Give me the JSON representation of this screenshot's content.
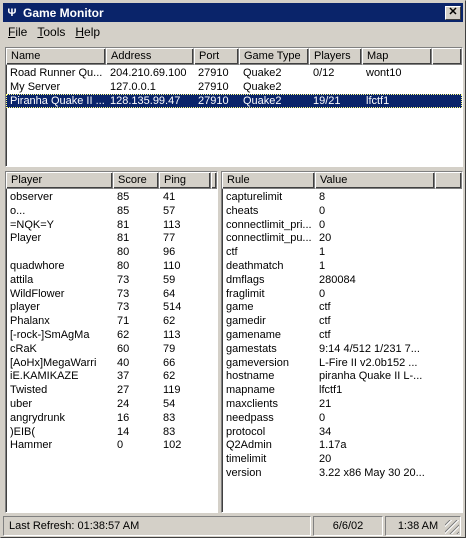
{
  "window": {
    "title": "Game Monitor",
    "app_icon": "Ψ",
    "close_glyph": "✕"
  },
  "menu": [
    {
      "label": "File",
      "mnemonic": "F",
      "rest": "ile"
    },
    {
      "label": "Tools",
      "mnemonic": "T",
      "rest": "ools"
    },
    {
      "label": "Help",
      "mnemonic": "H",
      "rest": "elp"
    }
  ],
  "servers": {
    "columns": [
      "Name",
      "Address",
      "Port",
      "Game Type",
      "Players",
      "Map"
    ],
    "rows": [
      {
        "name": "Road Runner Qu...",
        "address": "204.210.69.100",
        "port": "27910",
        "type": "Quake2",
        "players": "0/12",
        "map": "wont10",
        "selected": false
      },
      {
        "name": "My Server",
        "address": "127.0.0.1",
        "port": "27910",
        "type": "Quake2",
        "players": "",
        "map": "",
        "selected": false
      },
      {
        "name": "Piranha Quake II ...",
        "address": "128.135.99.47",
        "port": "27910",
        "type": "Quake2",
        "players": "19/21",
        "map": "lfctf1",
        "selected": true
      }
    ]
  },
  "players": {
    "columns": [
      "Player",
      "Score",
      "Ping"
    ],
    "rows": [
      [
        "observer",
        "85",
        "41"
      ],
      [
        "o...",
        "85",
        "57"
      ],
      [
        "=NQK=Y",
        "81",
        "113"
      ],
      [
        "Player",
        "81",
        "77"
      ],
      [
        "",
        "80",
        "96"
      ],
      [
        "quadwhore",
        "80",
        "110"
      ],
      [
        "attila",
        "73",
        "59"
      ],
      [
        "WildFlower",
        "73",
        "64"
      ],
      [
        "player",
        "73",
        "514"
      ],
      [
        "Phalanx",
        "71",
        "62"
      ],
      [
        "[-rock-]SmAgMa",
        "62",
        "113"
      ],
      [
        "cRaK",
        "60",
        "79"
      ],
      [
        "[AoHx]MegaWarri",
        "40",
        "66"
      ],
      [
        "iE.KAMIKAZE",
        "37",
        "62"
      ],
      [
        "Twisted",
        "27",
        "119"
      ],
      [
        "uber",
        "24",
        "54"
      ],
      [
        "angrydrunk",
        "16",
        "83"
      ],
      [
        ")EIB(",
        "14",
        "83"
      ],
      [
        "Hammer",
        "0",
        "102"
      ]
    ]
  },
  "rules": {
    "columns": [
      "Rule",
      "Value"
    ],
    "rows": [
      [
        "capturelimit",
        "8"
      ],
      [
        "cheats",
        "0"
      ],
      [
        "connectlimit_pri...",
        "0"
      ],
      [
        "connectlimit_pu...",
        "20"
      ],
      [
        "ctf",
        "1"
      ],
      [
        "deathmatch",
        "1"
      ],
      [
        "dmflags",
        "280084"
      ],
      [
        "fraglimit",
        "0"
      ],
      [
        "game",
        "ctf"
      ],
      [
        "gamedir",
        "ctf"
      ],
      [
        "gamename",
        "ctf"
      ],
      [
        "gamestats",
        "9:14 4/512 1/231 7..."
      ],
      [
        "gameversion",
        "L-Fire II v2.0b152 ..."
      ],
      [
        "hostname",
        "piranha Quake II L-..."
      ],
      [
        "mapname",
        "lfctf1"
      ],
      [
        "maxclients",
        "21"
      ],
      [
        "needpass",
        "0"
      ],
      [
        "protocol",
        "34"
      ],
      [
        "Q2Admin",
        "1.17a"
      ],
      [
        "timelimit",
        "20"
      ],
      [
        "version",
        "3.22 x86 May 30 20..."
      ]
    ]
  },
  "status": {
    "last_refresh": "Last Refresh: 01:38:57 AM",
    "date": "6/6/02",
    "time": "1:38 AM"
  }
}
